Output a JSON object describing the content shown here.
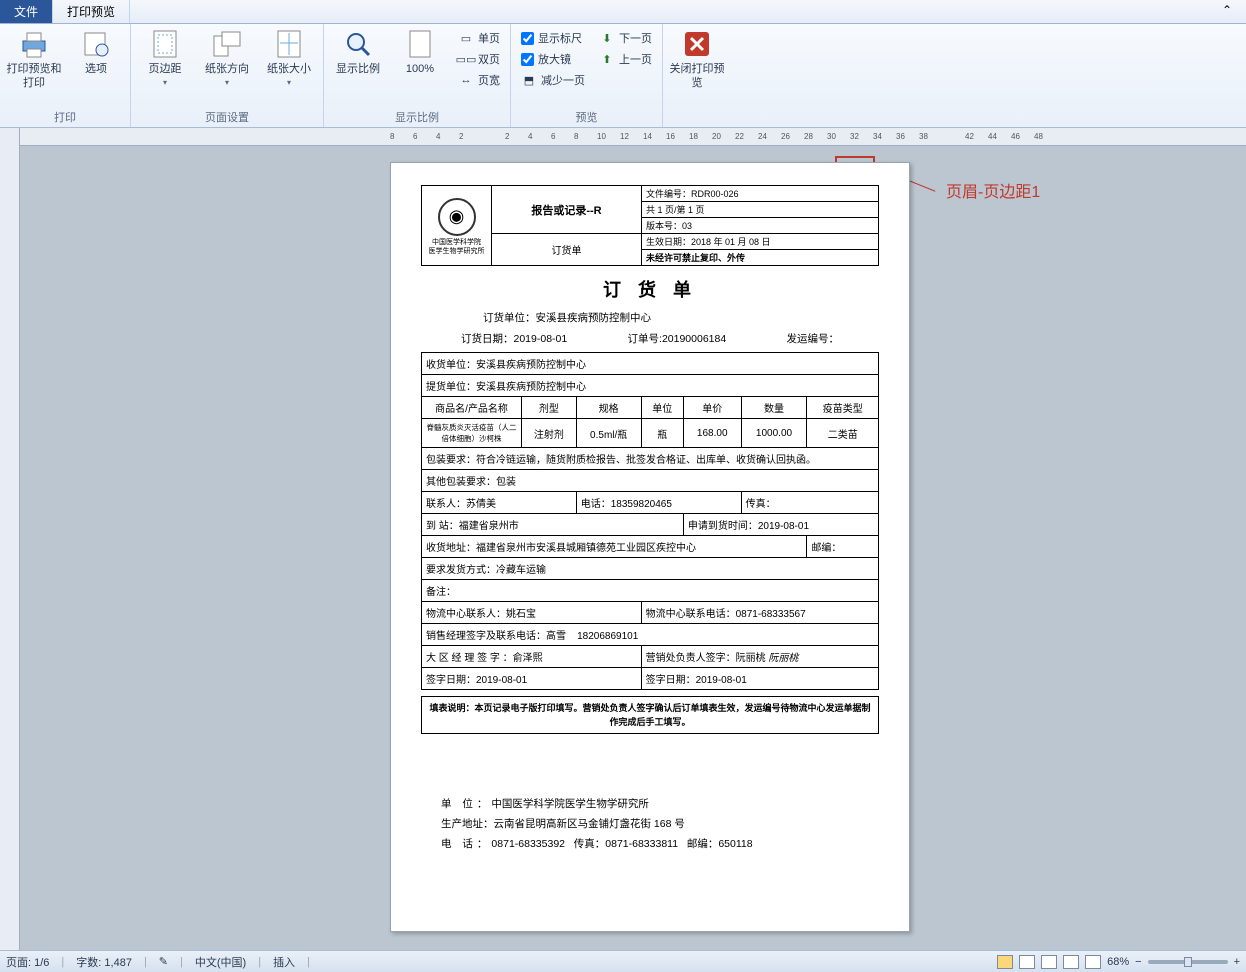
{
  "tabs": {
    "file": "文件",
    "preview": "打印预览"
  },
  "ribbon": {
    "print": {
      "title": "打印",
      "btn1": "打印预览和打印",
      "btn2": "选项"
    },
    "page_setup": {
      "title": "页面设置",
      "margins": "页边距",
      "orientation": "纸张方向",
      "size": "纸张大小"
    },
    "zoom": {
      "title": "显示比例",
      "zoom": "显示比例",
      "pct": "100%",
      "one": "单页",
      "two": "双页",
      "width": "页宽"
    },
    "preview": {
      "title": "预览",
      "ruler": "显示标尺",
      "magnifier": "放大镜",
      "less": "减少一页",
      "prev": "上一页",
      "next": "下一页"
    },
    "close": {
      "label": "关闭打印预览"
    }
  },
  "ruler_numbers": [
    "8",
    "6",
    "4",
    "2",
    "",
    "2",
    "4",
    "6",
    "8",
    "10",
    "12",
    "14",
    "16",
    "18",
    "20",
    "22",
    "24",
    "26",
    "28",
    "30",
    "32",
    "34",
    "36",
    "38",
    "",
    "42",
    "44",
    "46",
    "48"
  ],
  "callout": "页眉-页边距1",
  "doc": {
    "logo_org1": "中国医学科学院",
    "logo_org2": "医学生物学研究所",
    "hdr_title1": "报告或记录--R",
    "hdr_title2": "订货单",
    "file_code_lbl": "文件编号：",
    "file_code": "RDR00-026",
    "pages": "共 1 页/第 1 页",
    "version_lbl": "版本号：",
    "version": "03",
    "eff_lbl": "生效日期：",
    "eff": "2018 年 01 月 08 日",
    "confidential": "未经许可禁止复印、外传",
    "title": "订 货 单",
    "order_unit_lbl": "订货单位：",
    "order_unit": "安溪县疾病预防控制中心",
    "order_date_lbl": "订货日期：",
    "order_date": "2019-08-01",
    "order_no_lbl": "订单号:",
    "order_no": "20190006184",
    "ship_no_lbl": "发运编号：",
    "ship_no": "",
    "recv_unit_lbl": "收货单位：",
    "recv_unit": "安溪县疾病预防控制中心",
    "pick_unit_lbl": "提货单位：",
    "pick_unit": "安溪县疾病预防控制中心",
    "cols": {
      "name": "商品名/产品名称",
      "form": "剂型",
      "spec": "规格",
      "unit": "单位",
      "price": "单价",
      "qty": "数量",
      "vtype": "疫苗类型"
    },
    "row": {
      "name": "脊髓灰质炎灭活疫苗（人二倍体细胞）沙柯株",
      "form": "注射剂",
      "spec": "0.5ml/瓶",
      "unit": "瓶",
      "price": "168.00",
      "qty": "1000.00",
      "vtype": "二类苗"
    },
    "pack_req_lbl": "包装要求：",
    "pack_req": "符合冷链运输，随货附质检报告、批签发合格证、出库单、收货确认回执函。",
    "other_pack_lbl": "其他包装要求：",
    "other_pack": "包装",
    "contact_lbl": "联系人：",
    "contact": "苏倩美",
    "tel_lbl": "电话：",
    "tel": "18359820465",
    "fax_lbl": "传真：",
    "dest_lbl": "到    站：",
    "dest": "福建省泉州市",
    "req_time_lbl": "申请到货时间：",
    "req_time": "2019-08-01",
    "addr_lbl": "收货地址：",
    "addr": "福建省泉州市安溪县城厢镇德苑工业园区疾控中心",
    "post_lbl": "邮编：",
    "trans_lbl": "要求发货方式：",
    "trans": "冷藏车运输",
    "remark_lbl": "备注：",
    "wl_contact_lbl": "物流中心联系人：",
    "wl_contact": "姚石宝",
    "wl_tel_lbl": "物流中心联系电话：",
    "wl_tel": "0871-68333567",
    "mgr_lbl": "销售经理签字及联系电话：",
    "mgr": "高雪",
    "mgr_tel": "18206869101",
    "area_mgr_lbl": "大 区 经 理 签 字 ：",
    "area_mgr": "俞泽熙",
    "sales_lbl": "营销处负责人签字：",
    "sales": "阮丽桃",
    "sales_sign": "阮丽桃",
    "sign_date_lbl": "签字日期：",
    "sign_date1": "2019-08-01",
    "sign_date2": "2019-08-01",
    "note": "填表说明：本页记录电子版打印填写。营销处负责人签字确认后订单填表生效，发运编号待物流中心发运单据制作完成后手工填写。",
    "f_unit_lbl": "单      位：",
    "f_unit": "中国医学科学院医学生物学研究所",
    "f_addr_lbl": "生产地址：",
    "f_addr": "云南省昆明高新区马金铺灯盏花街 168 号",
    "f_tel_lbl": "电      话：",
    "f_tel": "0871-68335392",
    "f_fax_lbl": "传真：",
    "f_fax": "0871-68333811",
    "f_post_lbl": "邮编：",
    "f_post": "650118"
  },
  "status": {
    "page_lbl": "页面:",
    "page": "1/6",
    "words_lbl": "字数:",
    "words": "1,487",
    "lang": "中文(中国)",
    "mode": "插入",
    "zoom": "68%"
  }
}
